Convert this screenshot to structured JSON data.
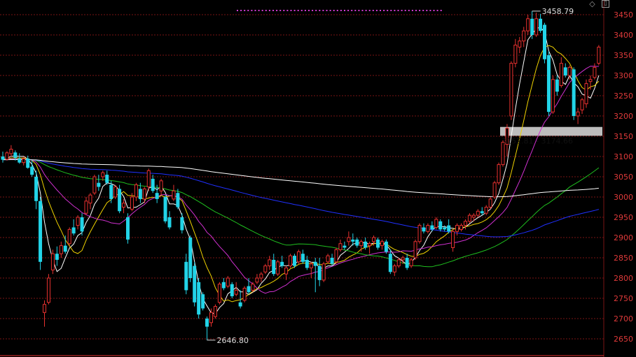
{
  "window_controls": {
    "restore_glyph": "◇",
    "maximize_glyph": "▯"
  },
  "colors": {
    "up": "#e8312f",
    "down": "#22d4e8",
    "grid": "#7a1515",
    "axis_text": "#e03a3a",
    "ma5": "#ffffff",
    "ma10": "#f0d200",
    "ma20": "#d030d0",
    "ma60": "#1fbf1f",
    "ma120": "#2030ff",
    "ma250": "#ffffff",
    "marker": "#d23ad2",
    "band": "#bdbdbd"
  },
  "chart_data": {
    "type": "candlestick",
    "title": "",
    "xlabel": "",
    "ylabel": "",
    "ylim": [
      2630,
      3480
    ],
    "grid": true,
    "y_ticks": [
      3450,
      3400,
      3350,
      3300,
      3250,
      3200,
      3150,
      3100,
      3050,
      3000,
      2950,
      2900,
      2850,
      2800,
      2750,
      2700,
      2650
    ],
    "candles": [
      {
        "o": 3100,
        "h": 3112,
        "l": 3085,
        "c": 3092
      },
      {
        "o": 3093,
        "h": 3113,
        "l": 3090,
        "c": 3109
      },
      {
        "o": 3107,
        "h": 3128,
        "l": 3100,
        "c": 3118
      },
      {
        "o": 3110,
        "h": 3115,
        "l": 3090,
        "c": 3097
      },
      {
        "o": 3095,
        "h": 3108,
        "l": 3082,
        "c": 3085
      },
      {
        "o": 3085,
        "h": 3100,
        "l": 3078,
        "c": 3094
      },
      {
        "o": 3095,
        "h": 3102,
        "l": 3070,
        "c": 3072
      },
      {
        "o": 3075,
        "h": 3090,
        "l": 3050,
        "c": 3055
      },
      {
        "o": 3050,
        "h": 3065,
        "l": 2970,
        "c": 2990
      },
      {
        "o": 2990,
        "h": 3000,
        "l": 2820,
        "c": 2840
      },
      {
        "o": 2715,
        "h": 2745,
        "l": 2680,
        "c": 2735
      },
      {
        "o": 2740,
        "h": 2810,
        "l": 2735,
        "c": 2800
      },
      {
        "o": 2820,
        "h": 2870,
        "l": 2810,
        "c": 2860
      },
      {
        "o": 2860,
        "h": 2878,
        "l": 2830,
        "c": 2845
      },
      {
        "o": 2860,
        "h": 2890,
        "l": 2850,
        "c": 2880
      },
      {
        "o": 2880,
        "h": 2905,
        "l": 2860,
        "c": 2865
      },
      {
        "o": 2885,
        "h": 2925,
        "l": 2880,
        "c": 2920
      },
      {
        "o": 2925,
        "h": 2945,
        "l": 2905,
        "c": 2910
      },
      {
        "o": 2930,
        "h": 2955,
        "l": 2920,
        "c": 2950
      },
      {
        "o": 2950,
        "h": 2960,
        "l": 2905,
        "c": 2915
      },
      {
        "o": 2960,
        "h": 3000,
        "l": 2955,
        "c": 2990
      },
      {
        "o": 2985,
        "h": 3010,
        "l": 2970,
        "c": 3005
      },
      {
        "o": 3010,
        "h": 3055,
        "l": 3005,
        "c": 3050
      },
      {
        "o": 3035,
        "h": 3055,
        "l": 3015,
        "c": 3025
      },
      {
        "o": 3050,
        "h": 3065,
        "l": 3040,
        "c": 3060
      },
      {
        "o": 3055,
        "h": 3065,
        "l": 3030,
        "c": 3035
      },
      {
        "o": 3030,
        "h": 3040,
        "l": 2985,
        "c": 2995
      },
      {
        "o": 3000,
        "h": 3030,
        "l": 2995,
        "c": 3025
      },
      {
        "o": 3020,
        "h": 3030,
        "l": 2960,
        "c": 2965
      },
      {
        "o": 2975,
        "h": 2995,
        "l": 2960,
        "c": 2985
      },
      {
        "o": 2950,
        "h": 2960,
        "l": 2885,
        "c": 2895
      },
      {
        "o": 2970,
        "h": 3010,
        "l": 2965,
        "c": 3000
      },
      {
        "o": 3000,
        "h": 3035,
        "l": 2990,
        "c": 3030
      },
      {
        "o": 3020,
        "h": 3035,
        "l": 2985,
        "c": 2995
      },
      {
        "o": 2995,
        "h": 3025,
        "l": 2985,
        "c": 3020
      },
      {
        "o": 3025,
        "h": 3070,
        "l": 3015,
        "c": 3065
      },
      {
        "o": 3045,
        "h": 3055,
        "l": 3010,
        "c": 3015
      },
      {
        "o": 3010,
        "h": 3030,
        "l": 2985,
        "c": 2995
      },
      {
        "o": 3015,
        "h": 3045,
        "l": 3005,
        "c": 3040
      },
      {
        "o": 3000,
        "h": 3005,
        "l": 2935,
        "c": 2940
      },
      {
        "o": 2950,
        "h": 2965,
        "l": 2920,
        "c": 2925
      },
      {
        "o": 2995,
        "h": 3030,
        "l": 2990,
        "c": 3015
      },
      {
        "o": 3010,
        "h": 3020,
        "l": 2970,
        "c": 2975
      },
      {
        "o": 2950,
        "h": 2960,
        "l": 2910,
        "c": 2918
      },
      {
        "o": 2840,
        "h": 2860,
        "l": 2760,
        "c": 2770
      },
      {
        "o": 2900,
        "h": 2905,
        "l": 2790,
        "c": 2800
      },
      {
        "o": 2830,
        "h": 2840,
        "l": 2730,
        "c": 2740
      },
      {
        "o": 2790,
        "h": 2800,
        "l": 2700,
        "c": 2710
      },
      {
        "o": 2760,
        "h": 2765,
        "l": 2720,
        "c": 2725
      },
      {
        "o": 2700,
        "h": 2705,
        "l": 2646.8,
        "c": 2680
      },
      {
        "o": 2690,
        "h": 2725,
        "l": 2680,
        "c": 2715
      },
      {
        "o": 2705,
        "h": 2735,
        "l": 2700,
        "c": 2730
      },
      {
        "o": 2740,
        "h": 2790,
        "l": 2735,
        "c": 2785
      },
      {
        "o": 2790,
        "h": 2800,
        "l": 2770,
        "c": 2775
      },
      {
        "o": 2780,
        "h": 2805,
        "l": 2775,
        "c": 2800
      },
      {
        "o": 2785,
        "h": 2790,
        "l": 2750,
        "c": 2755
      },
      {
        "o": 2760,
        "h": 2790,
        "l": 2755,
        "c": 2770
      },
      {
        "o": 2740,
        "h": 2770,
        "l": 2725,
        "c": 2730
      },
      {
        "o": 2745,
        "h": 2780,
        "l": 2740,
        "c": 2775
      },
      {
        "o": 2780,
        "h": 2800,
        "l": 2760,
        "c": 2765
      },
      {
        "o": 2770,
        "h": 2790,
        "l": 2765,
        "c": 2785
      },
      {
        "o": 2790,
        "h": 2810,
        "l": 2785,
        "c": 2800
      },
      {
        "o": 2800,
        "h": 2815,
        "l": 2790,
        "c": 2810
      },
      {
        "o": 2815,
        "h": 2835,
        "l": 2810,
        "c": 2830
      },
      {
        "o": 2830,
        "h": 2855,
        "l": 2820,
        "c": 2845
      },
      {
        "o": 2845,
        "h": 2860,
        "l": 2805,
        "c": 2810
      },
      {
        "o": 2810,
        "h": 2845,
        "l": 2805,
        "c": 2840
      },
      {
        "o": 2840,
        "h": 2855,
        "l": 2825,
        "c": 2830
      },
      {
        "o": 2810,
        "h": 2830,
        "l": 2795,
        "c": 2825
      },
      {
        "o": 2830,
        "h": 2860,
        "l": 2825,
        "c": 2855
      },
      {
        "o": 2855,
        "h": 2860,
        "l": 2825,
        "c": 2830
      },
      {
        "o": 2840,
        "h": 2870,
        "l": 2835,
        "c": 2865
      },
      {
        "o": 2860,
        "h": 2870,
        "l": 2835,
        "c": 2840
      },
      {
        "o": 2845,
        "h": 2855,
        "l": 2820,
        "c": 2825
      },
      {
        "o": 2825,
        "h": 2840,
        "l": 2800,
        "c": 2835
      },
      {
        "o": 2840,
        "h": 2850,
        "l": 2765,
        "c": 2830
      },
      {
        "o": 2830,
        "h": 2850,
        "l": 2780,
        "c": 2795
      },
      {
        "o": 2795,
        "h": 2840,
        "l": 2790,
        "c": 2835
      },
      {
        "o": 2840,
        "h": 2860,
        "l": 2835,
        "c": 2855
      },
      {
        "o": 2850,
        "h": 2860,
        "l": 2830,
        "c": 2835
      },
      {
        "o": 2840,
        "h": 2875,
        "l": 2835,
        "c": 2870
      },
      {
        "o": 2870,
        "h": 2895,
        "l": 2865,
        "c": 2885
      },
      {
        "o": 2880,
        "h": 2890,
        "l": 2870,
        "c": 2875
      },
      {
        "o": 2890,
        "h": 2915,
        "l": 2880,
        "c": 2900
      },
      {
        "o": 2895,
        "h": 2910,
        "l": 2880,
        "c": 2890
      },
      {
        "o": 2895,
        "h": 2900,
        "l": 2875,
        "c": 2880
      },
      {
        "o": 2880,
        "h": 2895,
        "l": 2865,
        "c": 2890
      },
      {
        "o": 2890,
        "h": 2900,
        "l": 2870,
        "c": 2875
      },
      {
        "o": 2880,
        "h": 2890,
        "l": 2860,
        "c": 2885
      },
      {
        "o": 2890,
        "h": 2905,
        "l": 2880,
        "c": 2900
      },
      {
        "o": 2895,
        "h": 2900,
        "l": 2870,
        "c": 2875
      },
      {
        "o": 2880,
        "h": 2895,
        "l": 2870,
        "c": 2890
      },
      {
        "o": 2890,
        "h": 2895,
        "l": 2860,
        "c": 2865
      },
      {
        "o": 2860,
        "h": 2870,
        "l": 2810,
        "c": 2815
      },
      {
        "o": 2815,
        "h": 2835,
        "l": 2805,
        "c": 2830
      },
      {
        "o": 2830,
        "h": 2850,
        "l": 2825,
        "c": 2845
      },
      {
        "o": 2845,
        "h": 2855,
        "l": 2835,
        "c": 2850
      },
      {
        "o": 2850,
        "h": 2860,
        "l": 2820,
        "c": 2825
      },
      {
        "o": 2830,
        "h": 2850,
        "l": 2825,
        "c": 2845
      },
      {
        "o": 2850,
        "h": 2895,
        "l": 2845,
        "c": 2890
      },
      {
        "o": 2890,
        "h": 2935,
        "l": 2885,
        "c": 2930
      },
      {
        "o": 2925,
        "h": 2935,
        "l": 2910,
        "c": 2915
      },
      {
        "o": 2915,
        "h": 2935,
        "l": 2910,
        "c": 2930
      },
      {
        "o": 2930,
        "h": 2940,
        "l": 2915,
        "c": 2920
      },
      {
        "o": 2925,
        "h": 2950,
        "l": 2920,
        "c": 2945
      },
      {
        "o": 2940,
        "h": 2945,
        "l": 2915,
        "c": 2920
      },
      {
        "o": 2925,
        "h": 2930,
        "l": 2915,
        "c": 2920
      },
      {
        "o": 2930,
        "h": 2945,
        "l": 2910,
        "c": 2915
      },
      {
        "o": 2875,
        "h": 2920,
        "l": 2865,
        "c": 2915
      },
      {
        "o": 2915,
        "h": 2935,
        "l": 2905,
        "c": 2930
      },
      {
        "o": 2920,
        "h": 2935,
        "l": 2915,
        "c": 2930
      },
      {
        "o": 2930,
        "h": 2945,
        "l": 2920,
        "c": 2940
      },
      {
        "o": 2940,
        "h": 2960,
        "l": 2935,
        "c": 2955
      },
      {
        "o": 2950,
        "h": 2960,
        "l": 2940,
        "c": 2955
      },
      {
        "o": 2955,
        "h": 2970,
        "l": 2950,
        "c": 2965
      },
      {
        "o": 2965,
        "h": 2975,
        "l": 2955,
        "c": 2960
      },
      {
        "o": 2960,
        "h": 2980,
        "l": 2955,
        "c": 2975
      },
      {
        "o": 2975,
        "h": 3000,
        "l": 2970,
        "c": 2995
      },
      {
        "o": 3000,
        "h": 3040,
        "l": 2995,
        "c": 3035
      },
      {
        "o": 3035,
        "h": 3085,
        "l": 3030,
        "c": 3080
      },
      {
        "o": 3080,
        "h": 3140,
        "l": 3075,
        "c": 3135
      },
      {
        "o": 3130,
        "h": 3180,
        "l": 3100,
        "c": 3170
      },
      {
        "o": 3200,
        "h": 3335,
        "l": 3190,
        "c": 3330
      },
      {
        "o": 3330,
        "h": 3390,
        "l": 3320,
        "c": 3375
      },
      {
        "o": 3370,
        "h": 3395,
        "l": 3355,
        "c": 3385
      },
      {
        "o": 3385,
        "h": 3420,
        "l": 3370,
        "c": 3410
      },
      {
        "o": 3410,
        "h": 3450,
        "l": 3400,
        "c": 3440
      },
      {
        "o": 3440,
        "h": 3458.79,
        "l": 3390,
        "c": 3400
      },
      {
        "o": 3400,
        "h": 3455,
        "l": 3395,
        "c": 3440
      },
      {
        "o": 3440,
        "h": 3452,
        "l": 3405,
        "c": 3410
      },
      {
        "o": 3425,
        "h": 3430,
        "l": 3330,
        "c": 3340
      },
      {
        "o": 3350,
        "h": 3360,
        "l": 3200,
        "c": 3210
      },
      {
        "o": 3210,
        "h": 3300,
        "l": 3205,
        "c": 3290
      },
      {
        "o": 3290,
        "h": 3300,
        "l": 3250,
        "c": 3260
      },
      {
        "o": 3275,
        "h": 3345,
        "l": 3270,
        "c": 3330
      },
      {
        "o": 3320,
        "h": 3330,
        "l": 3295,
        "c": 3300
      },
      {
        "o": 3300,
        "h": 3325,
        "l": 3290,
        "c": 3320
      },
      {
        "o": 3315,
        "h": 3320,
        "l": 3190,
        "c": 3200
      },
      {
        "o": 3200,
        "h": 3220,
        "l": 3180,
        "c": 3210
      },
      {
        "o": 3215,
        "h": 3245,
        "l": 3205,
        "c": 3240
      },
      {
        "o": 3230,
        "h": 3290,
        "l": 3220,
        "c": 3280
      },
      {
        "o": 3285,
        "h": 3300,
        "l": 3265,
        "c": 3290
      },
      {
        "o": 3295,
        "h": 3330,
        "l": 3290,
        "c": 3320
      },
      {
        "o": 3330,
        "h": 3375,
        "l": 3325,
        "c": 3370
      }
    ],
    "moving_averages": [
      {
        "name": "MA5",
        "period": 5
      },
      {
        "name": "MA10",
        "period": 10
      },
      {
        "name": "MA20",
        "period": 20
      },
      {
        "name": "MA60",
        "period": 60
      },
      {
        "name": "MA120",
        "period": 120
      },
      {
        "name": "MA250",
        "period": 250
      }
    ],
    "annotations": {
      "high": {
        "value": 3458.79,
        "label": "3458.79"
      },
      "low": {
        "value": 2646.8,
        "label": "2646.80"
      },
      "band": {
        "from": 3152.81,
        "to": 3174.66,
        "label": "3152.81 - 3174.66"
      }
    },
    "marker_row_count": 58
  }
}
